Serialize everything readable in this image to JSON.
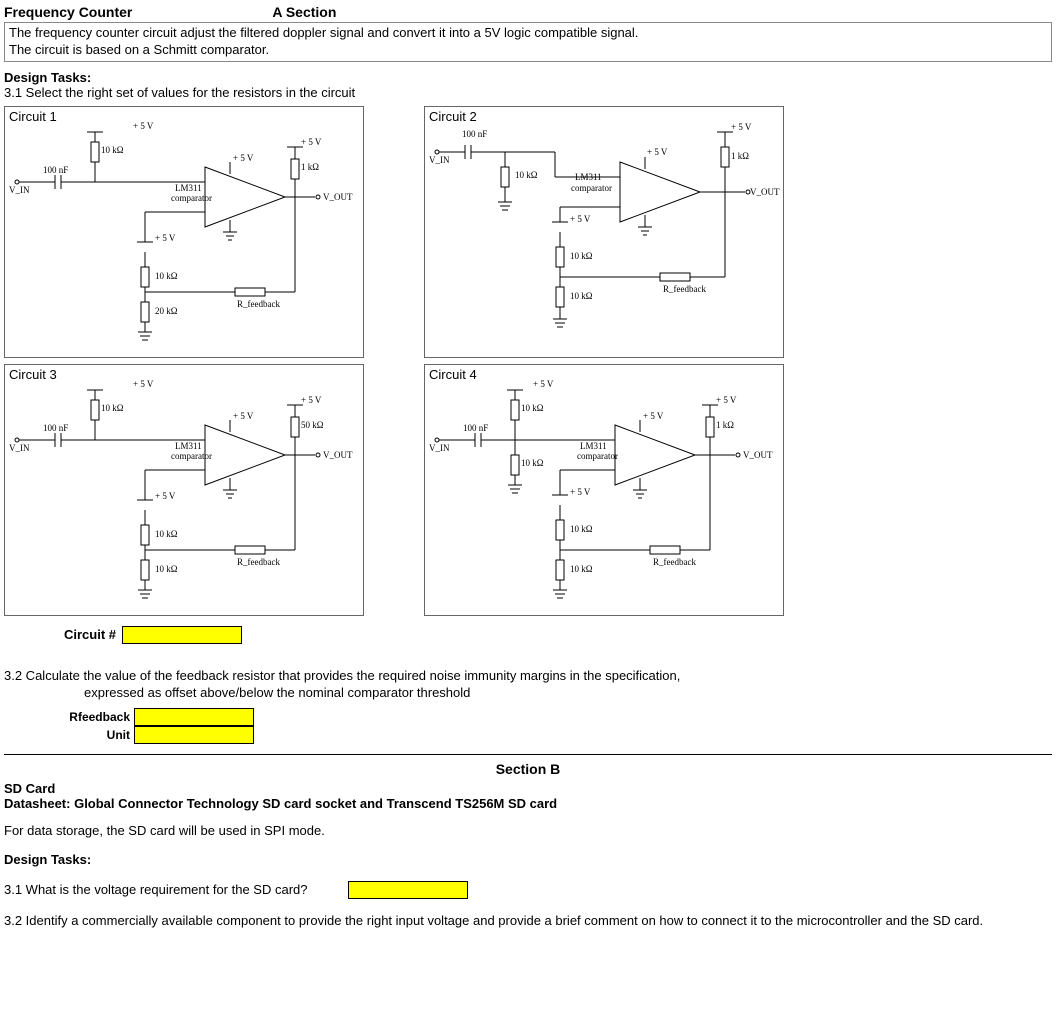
{
  "header": {
    "title": "Frequency Counter",
    "section": "A Section"
  },
  "intro": {
    "line1": "The frequency counter circuit adjust the filtered doppler signal and convert it into a 5V logic compatible signal.",
    "line2": "The circuit is based on a Schmitt comparator."
  },
  "design_tasks_header": "Design Tasks:",
  "task31": "3.1 Select the right set of values for the resistors in the circuit",
  "circuits": {
    "c1": {
      "title": "Circuit 1"
    },
    "c2": {
      "title": "Circuit 2"
    },
    "c3": {
      "title": "Circuit 3"
    },
    "c4": {
      "title": "Circuit 4"
    }
  },
  "schematic_labels": {
    "vin": "V_IN",
    "vout": "V_OUT",
    "cap": "100 nF",
    "plus5v": "+ 5 V",
    "lm311": "LM311",
    "comparator": "comparator",
    "rfeedback": "R_feedback",
    "r10k": "10 kΩ",
    "r20k": "20 kΩ",
    "r1k": "1 kΩ",
    "r50k": "50 kΩ"
  },
  "circuit_answer_label": "Circuit #",
  "task32": {
    "line1": "3.2 Calculate the value of the feedback resistor that provides the required noise immunity margins in the specification,",
    "line2": "expressed as offset above/below the nominal comparator threshold"
  },
  "rfeedback_label": "Rfeedback",
  "unit_label": "Unit",
  "section_b": {
    "header": "Section B",
    "sd_title": "SD Card",
    "datasheet": "Datasheet: Global Connector Technology SD card socket and Transcend TS256M SD card",
    "intro": "For data storage, the SD card will be used in SPI mode.",
    "tasks_header": "Design Tasks:",
    "q31": "3.1 What is the voltage requirement for the SD card?",
    "q32": "3.2 Identify a commercially available component to provide the right input voltage and provide a brief comment on how to connect it to the microcontroller and the SD card."
  }
}
